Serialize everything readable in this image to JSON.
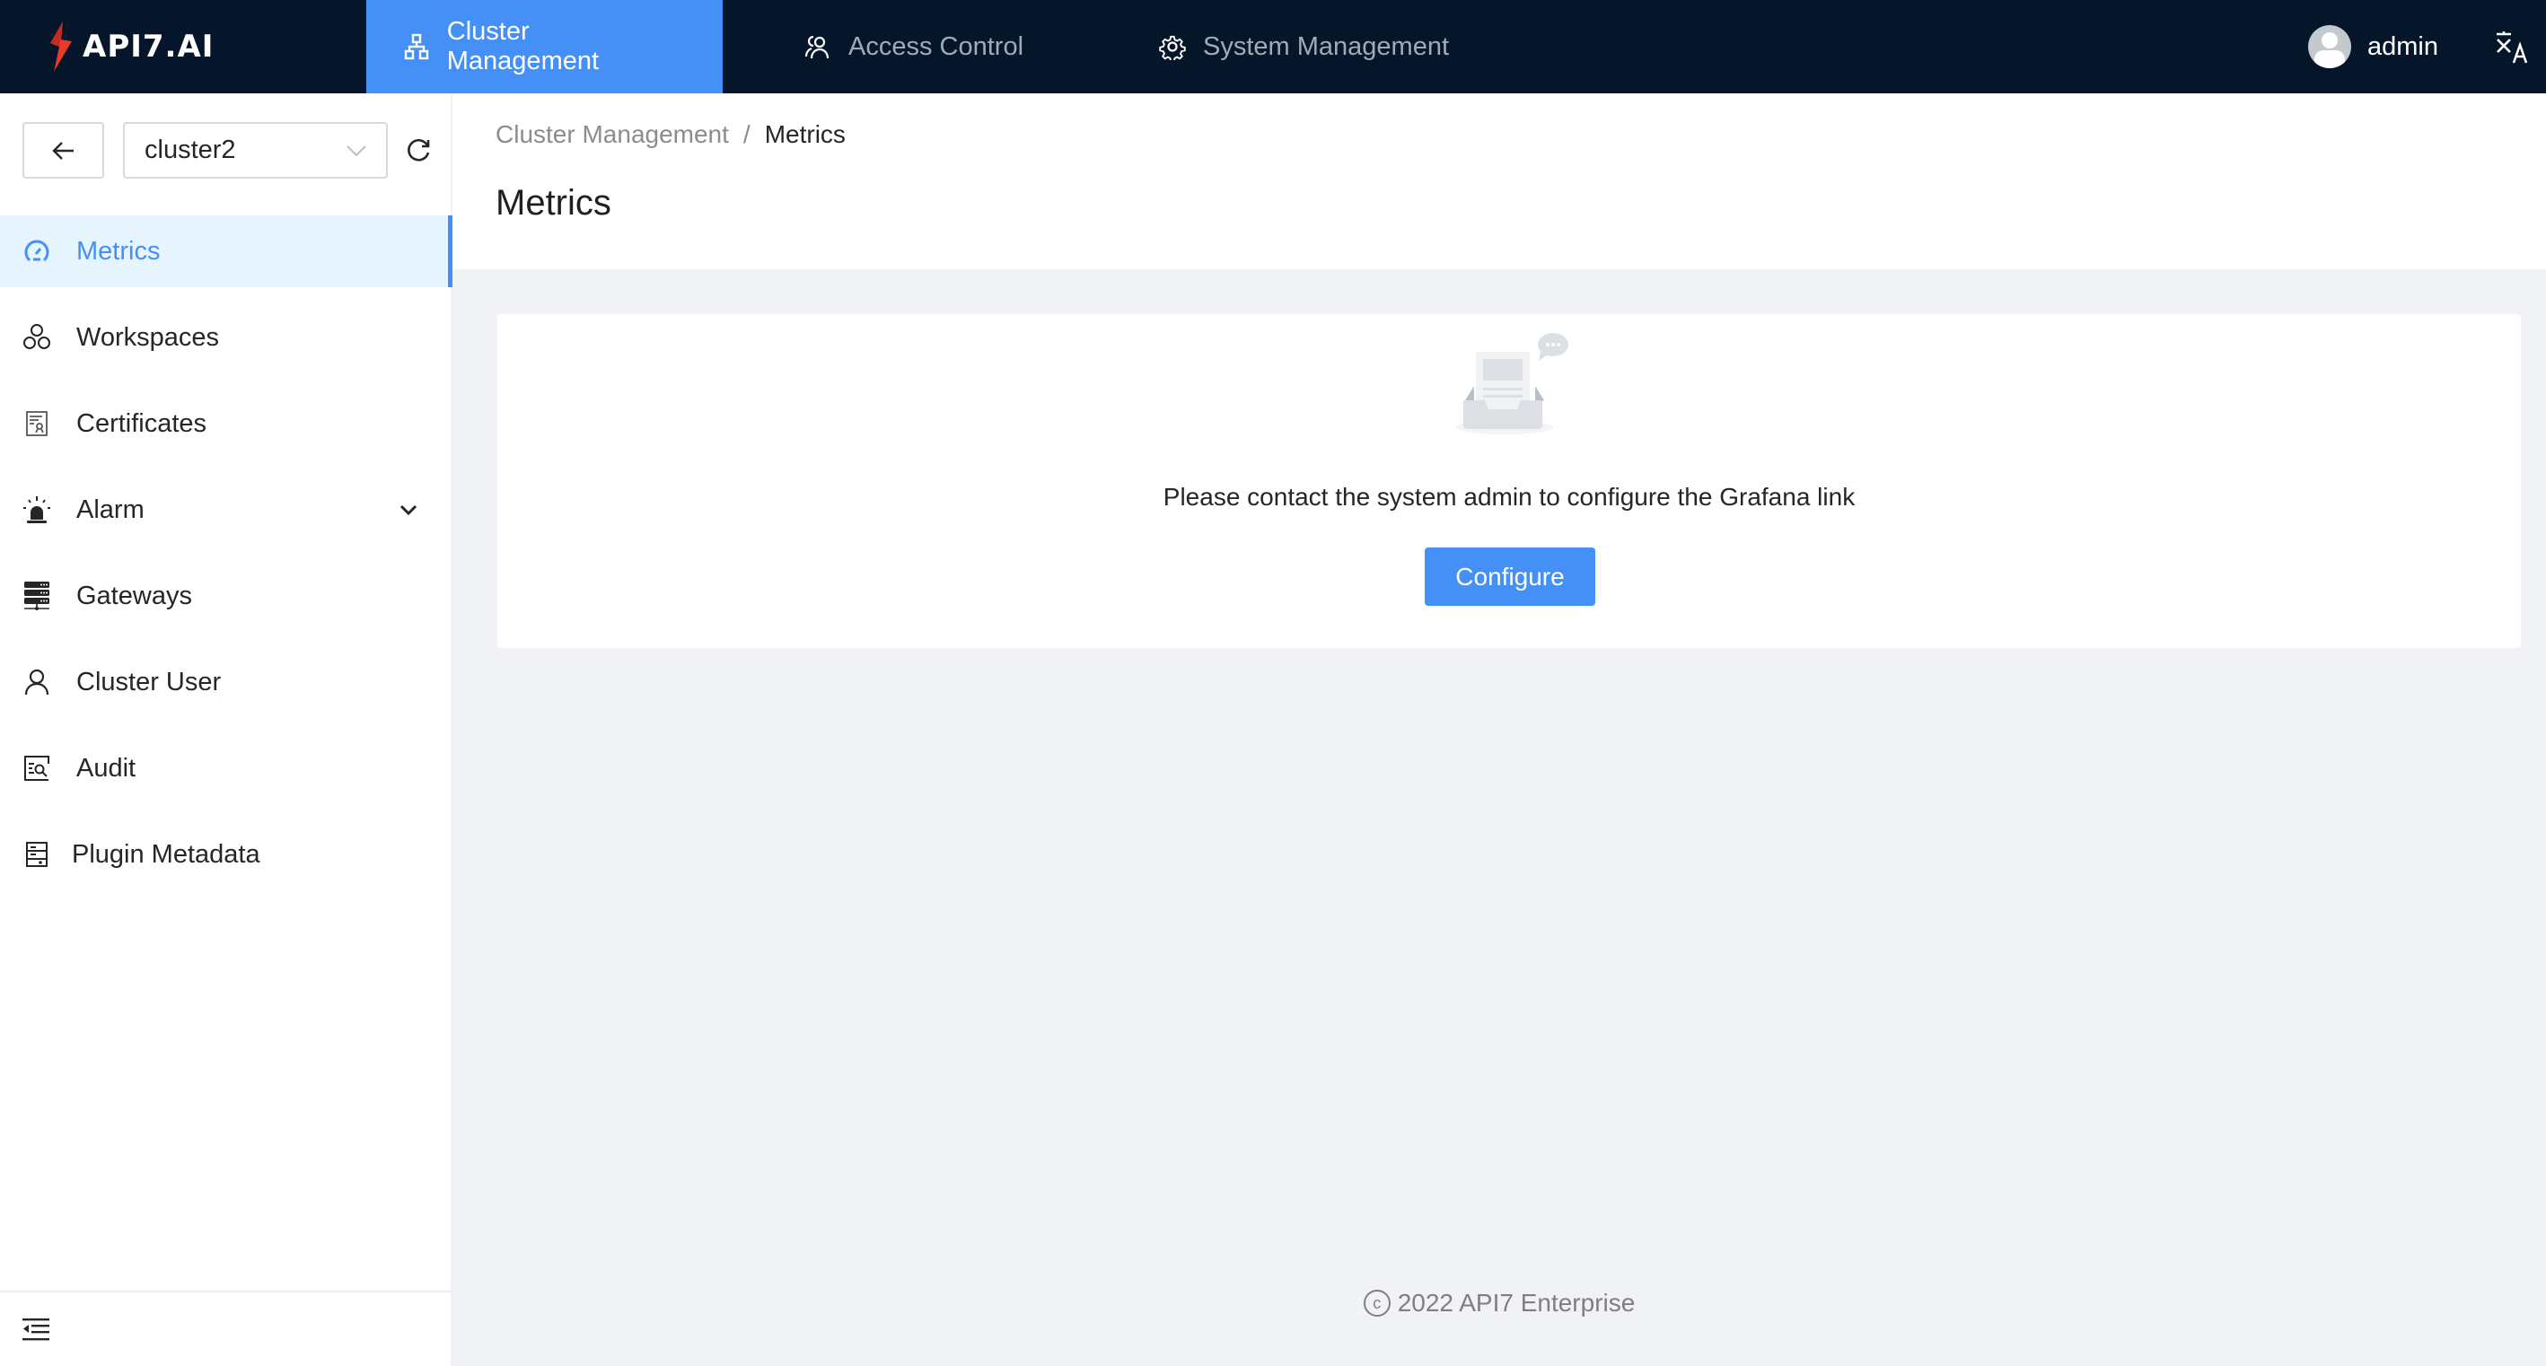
{
  "app": {
    "logo_text": "API7.AI"
  },
  "topnav": {
    "tabs": [
      {
        "label": "Cluster Management",
        "icon": "cluster-icon",
        "active": true
      },
      {
        "label": "Access Control",
        "icon": "users-icon",
        "active": false
      },
      {
        "label": "System Management",
        "icon": "gear-icon",
        "active": false
      }
    ],
    "user": {
      "name": "admin",
      "icon": "avatar-icon"
    },
    "language_icon": "translate-icon"
  },
  "sidebar": {
    "back_icon": "arrow-left-icon",
    "cluster_select": {
      "value": "cluster2",
      "icon": "chevron-down-icon"
    },
    "refresh_icon": "refresh-icon",
    "items": [
      {
        "label": "Metrics",
        "icon": "dashboard-icon",
        "active": true
      },
      {
        "label": "Workspaces",
        "icon": "workspaces-icon"
      },
      {
        "label": "Certificates",
        "icon": "certificate-icon"
      },
      {
        "label": "Alarm",
        "icon": "alarm-icon",
        "expandable": true
      },
      {
        "label": "Gateways",
        "icon": "server-icon"
      },
      {
        "label": "Cluster User",
        "icon": "user-icon"
      },
      {
        "label": "Audit",
        "icon": "audit-icon"
      },
      {
        "label": "Plugin Metadata",
        "icon": "metadata-icon"
      }
    ],
    "collapse_icon": "menu-fold-icon"
  },
  "breadcrumb": {
    "items": [
      "Cluster Management",
      "Metrics"
    ],
    "separator": "/"
  },
  "page": {
    "title": "Metrics"
  },
  "empty_state": {
    "icon": "empty-inbox-icon",
    "message": "Please contact the system admin to configure the Grafana link",
    "button_label": "Configure"
  },
  "footer": {
    "symbol": "c",
    "text": "2022 API7 Enterprise"
  },
  "colors": {
    "primary": "#4590f6",
    "nav_bg": "#05152a",
    "active_item_bg": "#e6f4fe",
    "content_bg": "#f0f2f5"
  }
}
